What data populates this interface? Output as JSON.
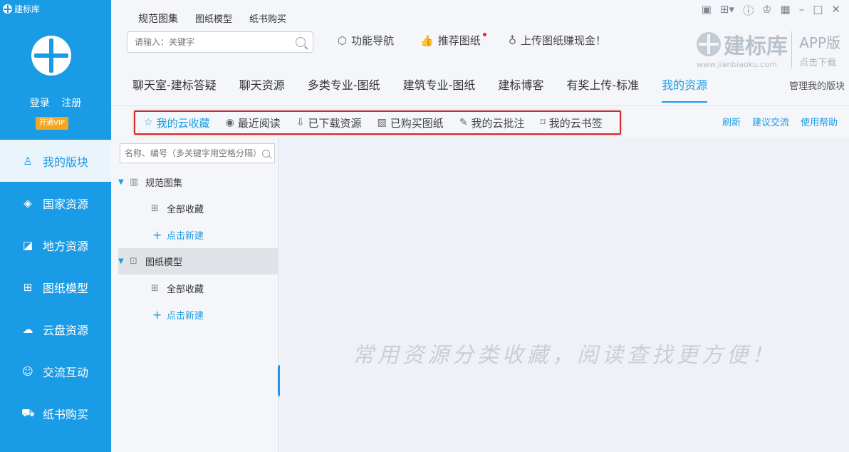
{
  "app": {
    "title": "建标库"
  },
  "auth": {
    "login": "登录",
    "register": "注册",
    "vip": "开通VIP"
  },
  "nav": [
    {
      "label": "我的版块",
      "icon": "person-icon",
      "active": true
    },
    {
      "label": "国家资源",
      "icon": "layers-icon",
      "active": false
    },
    {
      "label": "地方资源",
      "icon": "map-icon",
      "active": false
    },
    {
      "label": "图纸模型",
      "icon": "blueprint-icon",
      "active": false
    },
    {
      "label": "云盘资源",
      "icon": "cloud-icon",
      "active": false
    },
    {
      "label": "交流互动",
      "icon": "chat-icon",
      "active": false
    },
    {
      "label": "纸书购买",
      "icon": "cart-icon",
      "active": false
    }
  ],
  "top_tabs": [
    "规范图集",
    "图纸模型",
    "纸书购买"
  ],
  "search": {
    "placeholder": "请输入：关键字"
  },
  "features": [
    {
      "label": "功能导航",
      "icon": "cube-icon"
    },
    {
      "label": "推荐图纸",
      "icon": "thumbs-up-icon"
    },
    {
      "label": "上传图纸赚现金！",
      "icon": "money-bag-icon"
    }
  ],
  "brand": {
    "name": "建标库",
    "url": "www.jianbiaoku.com",
    "app_label": "APP版",
    "app_sub": "点击下载"
  },
  "main_tabs": [
    {
      "label": "聊天室-建标答疑",
      "active": false
    },
    {
      "label": "聊天资源",
      "active": false
    },
    {
      "label": "多类专业-图纸",
      "active": false
    },
    {
      "label": "建筑专业-图纸",
      "active": false
    },
    {
      "label": "建标博客",
      "active": false
    },
    {
      "label": "有奖上传-标准",
      "active": false
    },
    {
      "label": "我的资源",
      "active": true
    }
  ],
  "manage_label": "管理我的版块",
  "sub_items": [
    {
      "label": "我的云收藏",
      "icon": "star-icon",
      "active": true
    },
    {
      "label": "最近阅读",
      "icon": "eye-icon",
      "active": false
    },
    {
      "label": "已下载资源",
      "icon": "download-icon",
      "active": false
    },
    {
      "label": "已购买图纸",
      "icon": "image-icon",
      "active": false
    },
    {
      "label": "我的云批注",
      "icon": "edit-icon",
      "active": false
    },
    {
      "label": "我的云书签",
      "icon": "bookmark-icon",
      "active": false
    }
  ],
  "sub_right": {
    "refresh": "刷新",
    "feedback": "建议交流",
    "help": "使用帮助"
  },
  "tree": {
    "search_placeholder": "名称、编号（多关键字用空格分隔）",
    "group1": {
      "label": "规范图集",
      "child": "全部收藏",
      "add": "点击新建"
    },
    "group2": {
      "label": "图纸模型",
      "child": "全部收藏",
      "add": "点击新建"
    }
  },
  "empty_message": "常用资源分类收藏，阅读查找更方便！",
  "colors": {
    "accent": "#1a9be6",
    "highlight_border": "#d9252d",
    "vip": "#f5a623"
  }
}
